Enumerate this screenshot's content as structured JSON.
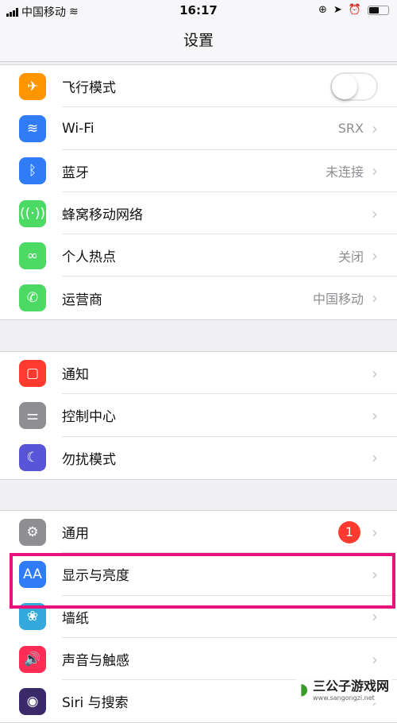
{
  "status": {
    "carrier": "中国移动",
    "time": "16:17",
    "battery_percent": 50
  },
  "nav": {
    "title": "设置"
  },
  "sections": [
    {
      "items": [
        {
          "label": "飞行模式",
          "icon": "airplane-icon",
          "color": "#ff9500",
          "glyph": "✈",
          "toggle": false
        },
        {
          "label": "Wi-Fi",
          "icon": "wifi-icon",
          "color": "#2f7cf6",
          "glyph": "≋",
          "value": "SRX"
        },
        {
          "label": "蓝牙",
          "icon": "bluetooth-icon",
          "color": "#2f7cf6",
          "glyph": "ᛒ",
          "value": "未连接"
        },
        {
          "label": "蜂窝移动网络",
          "icon": "cellular-icon",
          "color": "#4cd964",
          "glyph": "((·))",
          "value": ""
        },
        {
          "label": "个人热点",
          "icon": "hotspot-icon",
          "color": "#4cd964",
          "glyph": "∞",
          "value": "关闭"
        },
        {
          "label": "运营商",
          "icon": "phone-icon",
          "color": "#4cd964",
          "glyph": "✆",
          "value": "中国移动"
        }
      ]
    },
    {
      "items": [
        {
          "label": "通知",
          "icon": "notification-icon",
          "color": "#ff3b30",
          "glyph": "▢"
        },
        {
          "label": "控制中心",
          "icon": "control-center-icon",
          "color": "#8e8e93",
          "glyph": "⚌"
        },
        {
          "label": "勿扰模式",
          "icon": "moon-icon",
          "color": "#5856d6",
          "glyph": "☾"
        }
      ]
    },
    {
      "items": [
        {
          "label": "通用",
          "icon": "gear-icon",
          "color": "#8e8e93",
          "glyph": "⚙",
          "badge": "1"
        },
        {
          "label": "显示与亮度",
          "icon": "display-icon",
          "color": "#2f7cf6",
          "glyph": "AA"
        },
        {
          "label": "墙纸",
          "icon": "wallpaper-icon",
          "color": "#34aadc",
          "glyph": "❀"
        },
        {
          "label": "声音与触感",
          "icon": "sound-icon",
          "color": "#ff2d55",
          "glyph": "🔊"
        },
        {
          "label": "Siri 与搜索",
          "icon": "siri-icon",
          "color": "#3a2a6a",
          "glyph": "◉"
        }
      ]
    }
  ],
  "watermark": {
    "name": "三公子游戏网",
    "url": "www.sangongzi.net"
  }
}
